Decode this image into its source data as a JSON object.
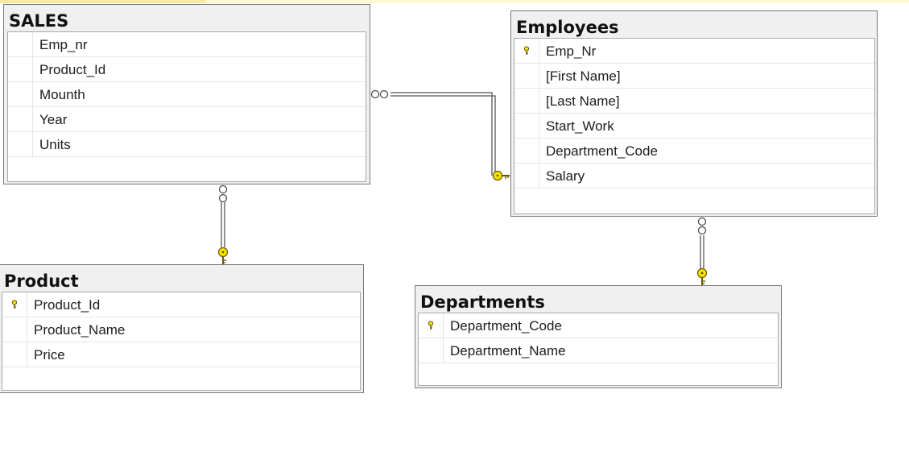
{
  "tables": {
    "sales": {
      "title": "SALES",
      "columns": [
        {
          "name": "Emp_nr",
          "primary_key": false
        },
        {
          "name": "Product_Id",
          "primary_key": false
        },
        {
          "name": "Mounth",
          "primary_key": false
        },
        {
          "name": "Year",
          "primary_key": false
        },
        {
          "name": "Units",
          "primary_key": false
        }
      ]
    },
    "employees": {
      "title": "Employees",
      "columns": [
        {
          "name": "Emp_Nr",
          "primary_key": true
        },
        {
          "name": "[First Name]",
          "primary_key": false
        },
        {
          "name": "[Last Name]",
          "primary_key": false
        },
        {
          "name": "Start_Work",
          "primary_key": false
        },
        {
          "name": "Department_Code",
          "primary_key": false
        },
        {
          "name": "Salary",
          "primary_key": false
        }
      ]
    },
    "product": {
      "title": "Product",
      "columns": [
        {
          "name": "Product_Id",
          "primary_key": true
        },
        {
          "name": "Product_Name",
          "primary_key": false
        },
        {
          "name": "Price",
          "primary_key": false
        }
      ]
    },
    "departments": {
      "title": "Departments",
      "columns": [
        {
          "name": "Department_Code",
          "primary_key": true
        },
        {
          "name": "Department_Name",
          "primary_key": false
        }
      ]
    }
  },
  "relationships": [
    {
      "from": "sales",
      "to": "employees",
      "from_end": "infinity-icon",
      "to_end": "key-icon"
    },
    {
      "from": "sales",
      "to": "product",
      "from_end": "infinity-icon",
      "to_end": "key-icon"
    },
    {
      "from": "employees",
      "to": "departments",
      "from_end": "infinity-icon",
      "to_end": "key-icon"
    }
  ],
  "colors": {
    "key_yellow": "#f5e400",
    "key_outline": "#6b5a00",
    "connector": "#6f6f6f"
  }
}
